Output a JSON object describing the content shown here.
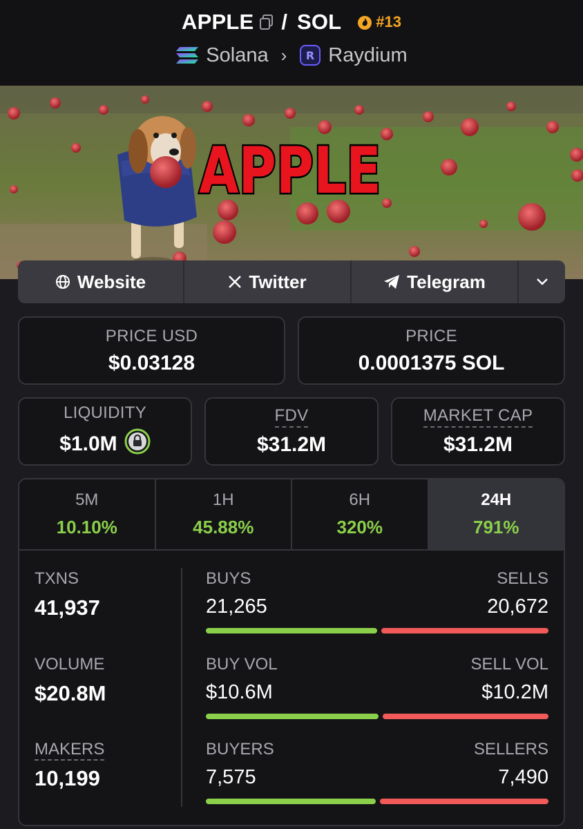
{
  "header": {
    "base_token": "APPLE",
    "separator": "/",
    "quote_token": "SOL",
    "rank": "#13",
    "chain": "Solana",
    "dex": "Raydium"
  },
  "banner": {
    "text": "APPLE"
  },
  "links": [
    {
      "label": "Website",
      "icon": "globe-icon"
    },
    {
      "label": "Twitter",
      "icon": "x-logo-icon"
    },
    {
      "label": "Telegram",
      "icon": "telegram-icon"
    }
  ],
  "prices": {
    "usd_label": "PRICE USD",
    "usd_value": "$0.03128",
    "native_label": "PRICE",
    "native_value": "0.0001375 SOL"
  },
  "metrics": {
    "liquidity_label": "LIQUIDITY",
    "liquidity_value": "$1.0M",
    "fdv_label": "FDV",
    "fdv_value": "$31.2M",
    "mcap_label": "MARKET CAP",
    "mcap_value": "$31.2M"
  },
  "timeframes": [
    {
      "label": "5M",
      "change": "10.10%"
    },
    {
      "label": "1H",
      "change": "45.88%"
    },
    {
      "label": "6H",
      "change": "320%"
    },
    {
      "label": "24H",
      "change": "791%"
    }
  ],
  "stats": {
    "txns_label": "TXNS",
    "txns_value": "41,937",
    "volume_label": "VOLUME",
    "volume_value": "$20.8M",
    "makers_label": "MAKERS",
    "makers_value": "10,199",
    "rows": [
      {
        "left_label": "BUYS",
        "right_label": "SELLS",
        "left_value": "21,265",
        "right_value": "20,672",
        "buy_fraction": 0.507
      },
      {
        "left_label": "BUY VOL",
        "right_label": "SELL VOL",
        "left_value": "$10.6M",
        "right_value": "$10.2M",
        "buy_fraction": 0.51
      },
      {
        "left_label": "BUYERS",
        "right_label": "SELLERS",
        "left_value": "7,575",
        "right_value": "7,490",
        "buy_fraction": 0.503
      }
    ]
  },
  "colors": {
    "positive": "#8bd04a",
    "negative": "#f25a5a",
    "rank": "#f5a623"
  }
}
